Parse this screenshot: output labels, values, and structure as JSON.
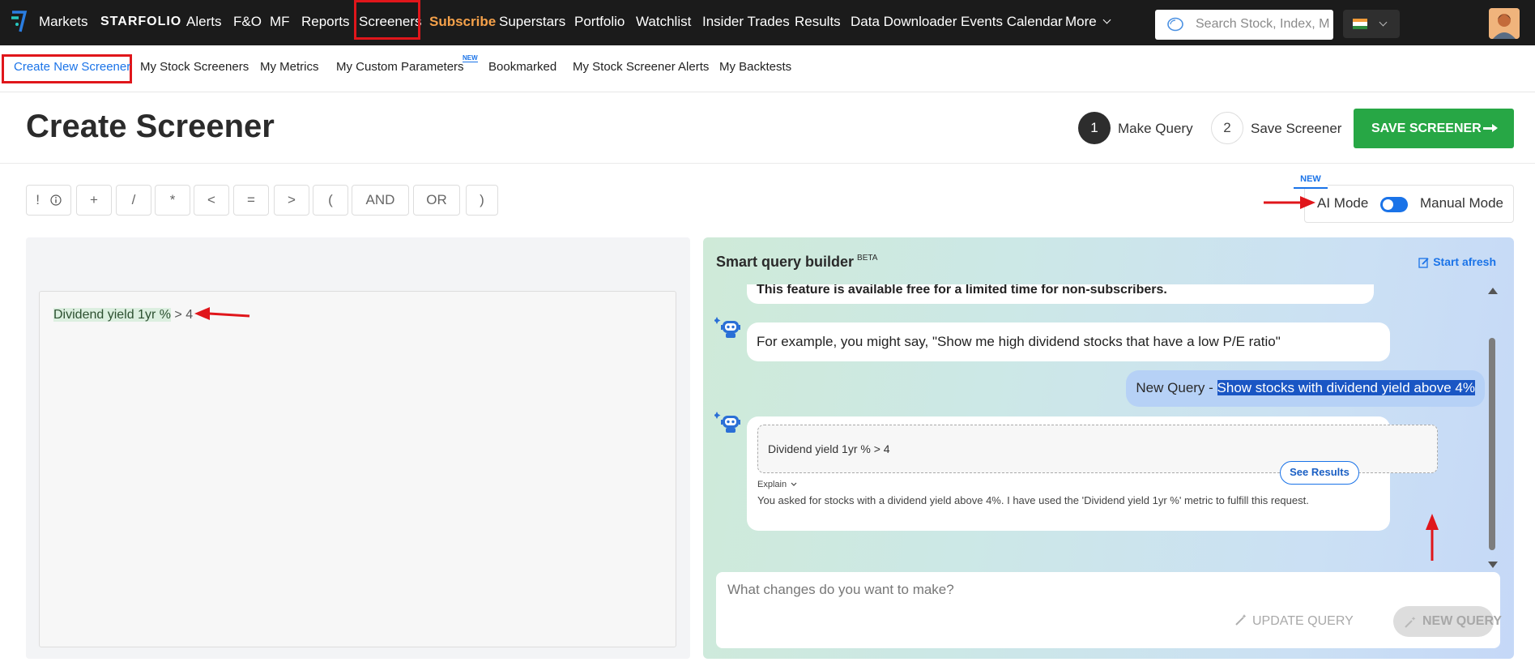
{
  "nav": {
    "items": [
      {
        "label": "Markets"
      },
      {
        "label": "STARFOLIO"
      },
      {
        "label": "Alerts"
      },
      {
        "label": "F&O"
      },
      {
        "label": "MF"
      },
      {
        "label": "Reports"
      },
      {
        "label": "Screeners"
      },
      {
        "label": "Subscribe"
      },
      {
        "label": "Superstars"
      },
      {
        "label": "Portfolio"
      },
      {
        "label": "Watchlist"
      },
      {
        "label": "Insider Trades"
      },
      {
        "label": "Results"
      },
      {
        "label": "Data Downloader"
      },
      {
        "label": "Events Calendar"
      },
      {
        "label": "More"
      }
    ],
    "search_placeholder": "Search Stock, Index, MF",
    "highlight_color": "#f5a14a"
  },
  "subnav": {
    "items": [
      {
        "label": "Create New Screener"
      },
      {
        "label": "My Stock Screeners"
      },
      {
        "label": "My Metrics"
      },
      {
        "label": "My Custom Parameters"
      },
      {
        "label": "Bookmarked"
      },
      {
        "label": "My Stock Screener Alerts"
      },
      {
        "label": "My Backtests"
      }
    ],
    "new_badge": "NEW"
  },
  "header": {
    "title": "Create Screener",
    "steps": [
      {
        "number": "1",
        "label": "Make Query"
      },
      {
        "number": "2",
        "label": "Save Screener"
      }
    ],
    "save_button": "SAVE SCREENER"
  },
  "operators": [
    "!",
    "+",
    "/",
    "*",
    "<",
    "=",
    ">",
    "(",
    "AND",
    "OR",
    ")"
  ],
  "mode": {
    "new_badge": "NEW",
    "ai_label": "AI Mode",
    "manual_label": "Manual Mode"
  },
  "editor": {
    "metric": "Dividend yield 1yr %",
    "operator": " > 4"
  },
  "smart_query": {
    "title": "Smart query builder",
    "beta": "BETA",
    "start_afresh": "Start afresh",
    "messages": {
      "notice": "This feature is available free for a limited time for non-subscribers.",
      "example": "For example, you might say, \"Show me high dividend stocks that have a low P/E ratio\"",
      "user_prefix": "New Query - ",
      "user_query": "Show stocks with dividend yield above 4%",
      "result_query": "Dividend yield 1yr % > 4",
      "see_results": "See Results",
      "explain_label": "Explain",
      "explanation": "You asked for stocks with a dividend yield above 4%. I have used the 'Dividend yield 1yr %' metric to fulfill this request."
    },
    "input_placeholder": "What changes do you want to make?",
    "update_button": "UPDATE QUERY",
    "new_query_button": "NEW QUERY"
  },
  "colors": {
    "accent": "#1a73e8",
    "save_green": "#27a745",
    "annotation_red": "#e0161b"
  }
}
